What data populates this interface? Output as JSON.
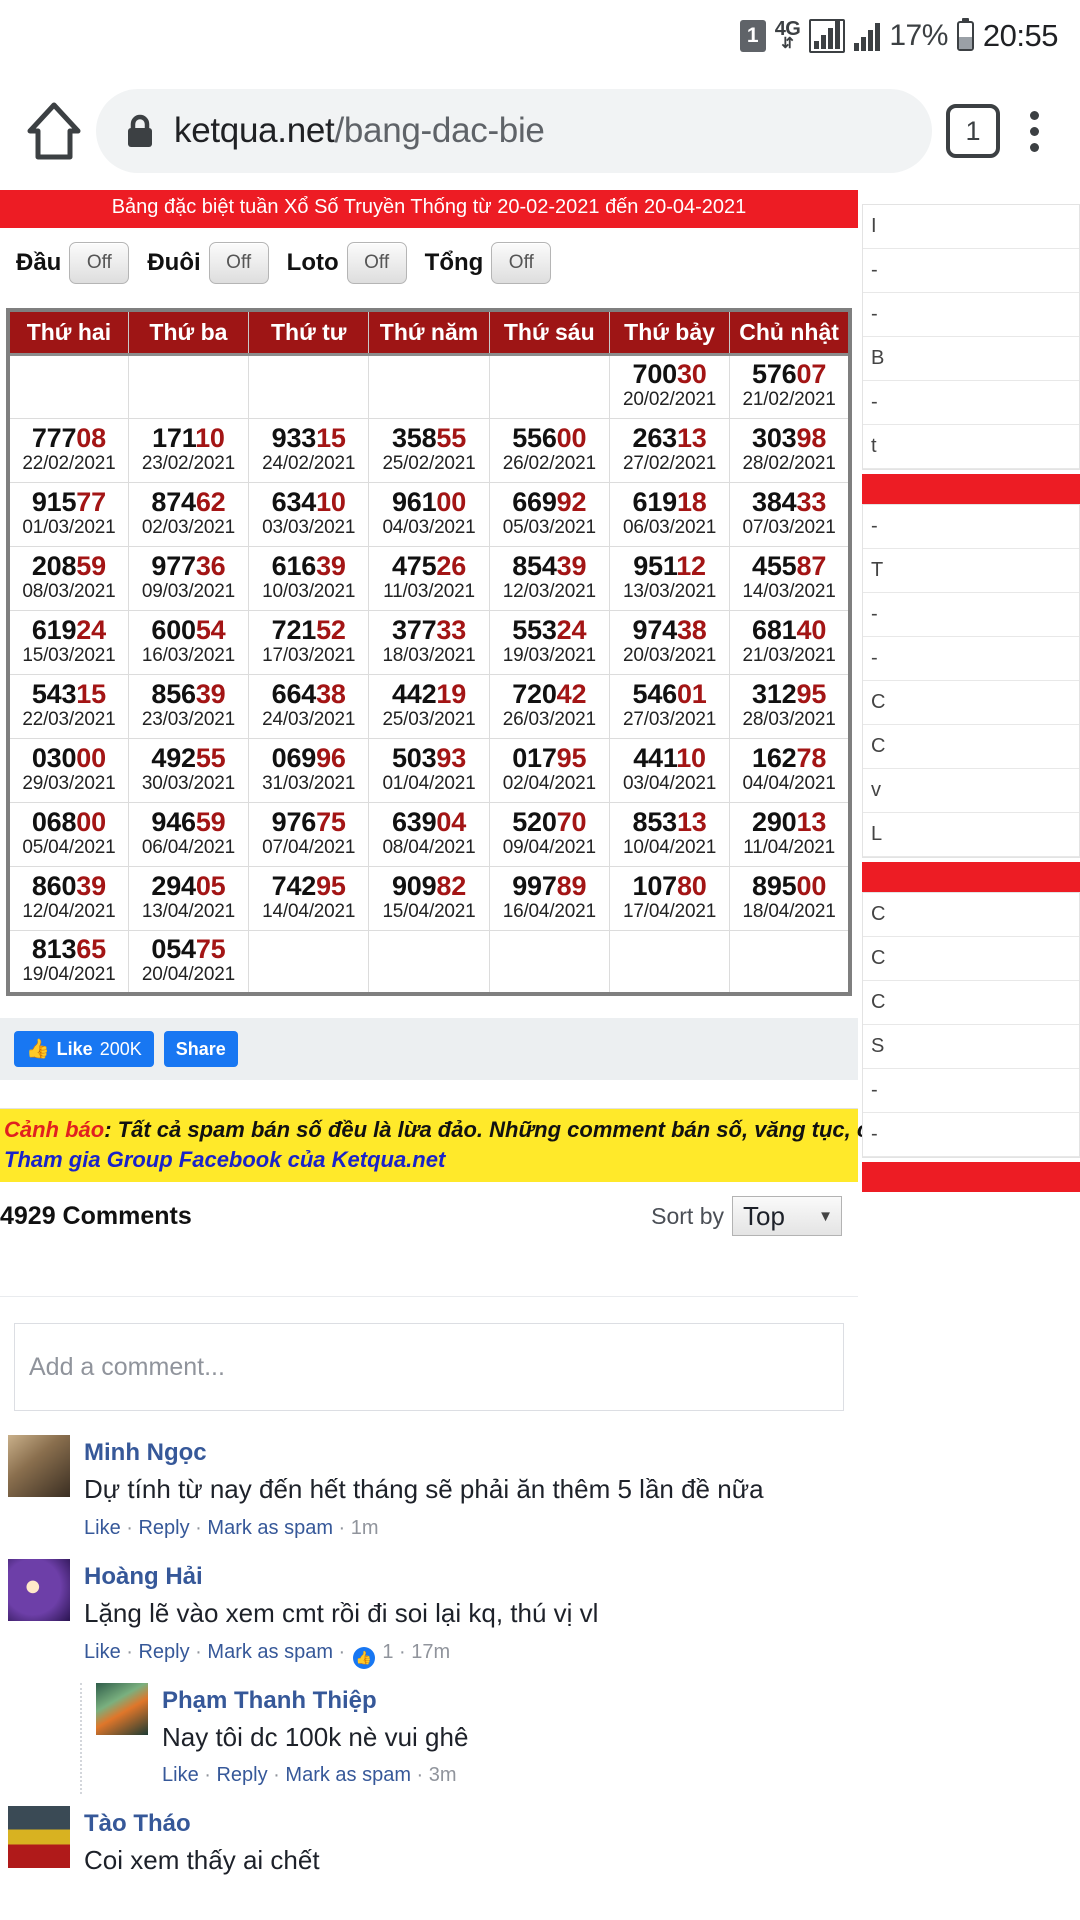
{
  "status_bar": {
    "sim": "1",
    "network": "4G",
    "battery_percent": "17%",
    "clock": "20:55"
  },
  "browser": {
    "url_host": "ketqua.net",
    "url_path": "/bang-dac-bie",
    "tab_count": "1",
    "home_icon": "home-icon",
    "lock_icon": "lock-icon",
    "menu_icon": "kebab-menu-icon"
  },
  "banner": {
    "title": "Bảng đặc biệt tuần Xổ Số Truyền Thống từ 20-02-2021 đến 20-04-2021"
  },
  "filters": [
    {
      "label": "Đầu",
      "state": "Off"
    },
    {
      "label": "Đuôi",
      "state": "Off"
    },
    {
      "label": "Loto",
      "state": "Off"
    },
    {
      "label": "Tổng",
      "state": "Off"
    }
  ],
  "table": {
    "headers": [
      "Thứ hai",
      "Thứ ba",
      "Thứ tư",
      "Thứ năm",
      "Thứ sáu",
      "Thứ bảy",
      "Chủ nhật"
    ],
    "rows": [
      [
        {
          "num": "",
          "date": ""
        },
        {
          "num": "",
          "date": ""
        },
        {
          "num": "",
          "date": ""
        },
        {
          "num": "",
          "date": ""
        },
        {
          "num": "",
          "date": ""
        },
        {
          "num": "70030",
          "date": "20/02/2021"
        },
        {
          "num": "57607",
          "date": "21/02/2021"
        }
      ],
      [
        {
          "num": "77708",
          "date": "22/02/2021"
        },
        {
          "num": "17110",
          "date": "23/02/2021"
        },
        {
          "num": "93315",
          "date": "24/02/2021"
        },
        {
          "num": "35855",
          "date": "25/02/2021"
        },
        {
          "num": "55600",
          "date": "26/02/2021"
        },
        {
          "num": "26313",
          "date": "27/02/2021"
        },
        {
          "num": "30398",
          "date": "28/02/2021"
        }
      ],
      [
        {
          "num": "91577",
          "date": "01/03/2021"
        },
        {
          "num": "87462",
          "date": "02/03/2021"
        },
        {
          "num": "63410",
          "date": "03/03/2021"
        },
        {
          "num": "96100",
          "date": "04/03/2021"
        },
        {
          "num": "66992",
          "date": "05/03/2021"
        },
        {
          "num": "61918",
          "date": "06/03/2021"
        },
        {
          "num": "38433",
          "date": "07/03/2021"
        }
      ],
      [
        {
          "num": "20859",
          "date": "08/03/2021"
        },
        {
          "num": "97736",
          "date": "09/03/2021"
        },
        {
          "num": "61639",
          "date": "10/03/2021"
        },
        {
          "num": "47526",
          "date": "11/03/2021"
        },
        {
          "num": "85439",
          "date": "12/03/2021"
        },
        {
          "num": "95112",
          "date": "13/03/2021"
        },
        {
          "num": "45587",
          "date": "14/03/2021"
        }
      ],
      [
        {
          "num": "61924",
          "date": "15/03/2021"
        },
        {
          "num": "60054",
          "date": "16/03/2021"
        },
        {
          "num": "72152",
          "date": "17/03/2021"
        },
        {
          "num": "37733",
          "date": "18/03/2021"
        },
        {
          "num": "55324",
          "date": "19/03/2021"
        },
        {
          "num": "97438",
          "date": "20/03/2021"
        },
        {
          "num": "68140",
          "date": "21/03/2021"
        }
      ],
      [
        {
          "num": "54315",
          "date": "22/03/2021"
        },
        {
          "num": "85639",
          "date": "23/03/2021"
        },
        {
          "num": "66438",
          "date": "24/03/2021"
        },
        {
          "num": "44219",
          "date": "25/03/2021"
        },
        {
          "num": "72042",
          "date": "26/03/2021"
        },
        {
          "num": "54601",
          "date": "27/03/2021"
        },
        {
          "num": "31295",
          "date": "28/03/2021"
        }
      ],
      [
        {
          "num": "03000",
          "date": "29/03/2021"
        },
        {
          "num": "49255",
          "date": "30/03/2021"
        },
        {
          "num": "06996",
          "date": "31/03/2021"
        },
        {
          "num": "50393",
          "date": "01/04/2021"
        },
        {
          "num": "01795",
          "date": "02/04/2021"
        },
        {
          "num": "44110",
          "date": "03/04/2021"
        },
        {
          "num": "16278",
          "date": "04/04/2021"
        }
      ],
      [
        {
          "num": "06800",
          "date": "05/04/2021"
        },
        {
          "num": "94659",
          "date": "06/04/2021"
        },
        {
          "num": "97675",
          "date": "07/04/2021"
        },
        {
          "num": "63904",
          "date": "08/04/2021"
        },
        {
          "num": "52070",
          "date": "09/04/2021"
        },
        {
          "num": "85313",
          "date": "10/04/2021"
        },
        {
          "num": "29013",
          "date": "11/04/2021"
        }
      ],
      [
        {
          "num": "86039",
          "date": "12/04/2021"
        },
        {
          "num": "29405",
          "date": "13/04/2021"
        },
        {
          "num": "74295",
          "date": "14/04/2021"
        },
        {
          "num": "90982",
          "date": "15/04/2021"
        },
        {
          "num": "99789",
          "date": "16/04/2021"
        },
        {
          "num": "10780",
          "date": "17/04/2021"
        },
        {
          "num": "89500",
          "date": "18/04/2021"
        }
      ],
      [
        {
          "num": "81365",
          "date": "19/04/2021"
        },
        {
          "num": "05475",
          "date": "20/04/2021"
        },
        {
          "num": "",
          "date": ""
        },
        {
          "num": "",
          "date": ""
        },
        {
          "num": "",
          "date": ""
        },
        {
          "num": "",
          "date": ""
        },
        {
          "num": "",
          "date": ""
        }
      ]
    ],
    "highlight_cells": [
      {
        "row": 5,
        "col": 2
      },
      {
        "row": 6,
        "col": 2
      },
      {
        "row": 7,
        "col": 2
      },
      {
        "row": 8,
        "col": 2
      }
    ],
    "soft_highlight_cells": [
      {
        "row": 9,
        "col": 2
      }
    ],
    "weekend_columns": [
      5,
      6
    ],
    "colors": {
      "header_bg": "#9e1515",
      "weekend_bg": "#dfeedc",
      "highlight_bg": "#ffbf00",
      "soft_highlight_bg": "#ffe8a8",
      "tail_digits": "#a31515",
      "banner_bg": "#ed1c24"
    }
  },
  "facebook": {
    "like_label": "Like",
    "like_count": "200K",
    "share_label": "Share"
  },
  "warning": {
    "prefix": "Cảnh báo",
    "text": ": Tất cả spam bán số đều là lừa đảo. Những comment bán số, văng tục, chửi bậy sẽ bị ban nick.",
    "link": "Tham gia Group Facebook của Ketqua.net"
  },
  "comments_header": {
    "count_label": "4929 Comments",
    "sort_label": "Sort by",
    "sort_value": "Top"
  },
  "comment_box": {
    "placeholder": "Add a comment..."
  },
  "comments": [
    {
      "name": "Minh Ngọc",
      "text": "Dự tính từ nay đến hết tháng sẽ phải ăn thêm 5 lần đề nữa",
      "actions": [
        "Like",
        "Reply",
        "Mark as spam"
      ],
      "time": "1m",
      "likes": "",
      "avatar": "avatar-minh-ngoc"
    },
    {
      "name": "Hoàng Hải",
      "text": "Lặng lẽ vào xem cmt rồi đi soi lại kq, thú vị vl",
      "actions": [
        "Like",
        "Reply",
        "Mark as spam"
      ],
      "time": "17m",
      "likes": "1",
      "avatar": "avatar-hoang-hai"
    },
    {
      "name": "Phạm Thanh Thiệp",
      "text": "Nay tôi dc 100k nè vui ghê",
      "actions": [
        "Like",
        "Reply",
        "Mark as spam"
      ],
      "time": "3m",
      "likes": "",
      "avatar": "avatar-pham-thanh-thiep",
      "is_reply": true
    },
    {
      "name": "Tào Tháo",
      "text": "Coi xem thấy ai chết",
      "actions": [],
      "time": "",
      "likes": "",
      "avatar": "avatar-tao-thao"
    }
  ]
}
